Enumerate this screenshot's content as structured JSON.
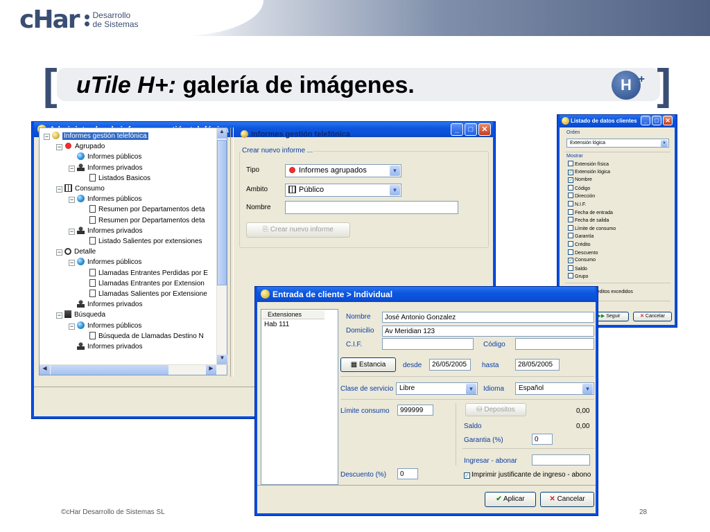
{
  "header": {
    "logo_text": "cHar",
    "logo_sub1": "Desarrollo",
    "logo_sub2": "de Sistemas",
    "title_italic": "uTile H+:",
    "title_rest": " galería de imágenes.",
    "badge_letter": "H"
  },
  "footer": {
    "copyright": "©cHar Desarrollo de Sistemas SL",
    "page": "28"
  },
  "win_admin": {
    "title": "Administrador de informes gestión telefónica",
    "tree": [
      {
        "label": "Informes gestión telefónica",
        "level": 0,
        "icon": "root-icon",
        "exp": "−"
      },
      {
        "label": "Agrupado",
        "level": 1,
        "icon": "red-icon",
        "exp": "−"
      },
      {
        "label": "Informes públicos",
        "level": 2,
        "icon": "globe-icon",
        "exp": ""
      },
      {
        "label": "Informes privados",
        "level": 2,
        "icon": "person-icon",
        "exp": "−"
      },
      {
        "label": "Listados Basicos",
        "level": 3,
        "icon": "document-icon",
        "exp": ""
      },
      {
        "label": "Consumo",
        "level": 1,
        "icon": "grid-icon",
        "exp": "−"
      },
      {
        "label": "Informes públicos",
        "level": 2,
        "icon": "globe-icon",
        "exp": "−"
      },
      {
        "label": "Resumen por Departamentos deta",
        "level": 3,
        "icon": "document-icon",
        "exp": ""
      },
      {
        "label": "Resumen por Departamentos deta",
        "level": 3,
        "icon": "document-icon",
        "exp": ""
      },
      {
        "label": "Informes privados",
        "level": 2,
        "icon": "person-icon",
        "exp": "−"
      },
      {
        "label": "Listado Salientes por extensiones",
        "level": 3,
        "icon": "document-icon",
        "exp": ""
      },
      {
        "label": "Detalle",
        "level": 1,
        "icon": "magnifier-icon",
        "exp": "−"
      },
      {
        "label": "Informes públicos",
        "level": 2,
        "icon": "globe-icon",
        "exp": "−"
      },
      {
        "label": "Llamadas Entrantes Perdidas por E",
        "level": 3,
        "icon": "document-icon",
        "exp": ""
      },
      {
        "label": "Llamadas Entrantes por Extension",
        "level": 3,
        "icon": "document-icon",
        "exp": ""
      },
      {
        "label": "Llamadas Salientes por Extensione",
        "level": 3,
        "icon": "document-icon",
        "exp": ""
      },
      {
        "label": "Informes privados",
        "level": 2,
        "icon": "person-icon",
        "exp": ""
      },
      {
        "label": "Búsqueda",
        "level": 1,
        "icon": "building-icon",
        "exp": "−"
      },
      {
        "label": "Informes públicos",
        "level": 2,
        "icon": "globe-icon",
        "exp": "−"
      },
      {
        "label": "Búsqueda de Llamadas Destino N",
        "level": 3,
        "icon": "document-icon",
        "exp": ""
      },
      {
        "label": "Informes privados",
        "level": 2,
        "icon": "person-icon",
        "exp": ""
      }
    ],
    "panel_title": "Informes gestión telefónica",
    "group_label": "Crear nuevo informe ...",
    "tipo_label": "Tipo",
    "tipo_value": "Informes agrupados",
    "ambito_label": "Ambito",
    "ambito_value": "Público",
    "nombre_label": "Nombre",
    "nombre_value": "",
    "create_button": "Crear nuevo informe"
  },
  "win_cliente": {
    "title": "Entrada de cliente > Individual",
    "ext_header": "Extensiones",
    "ext_items": [
      "Hab 111"
    ],
    "nombre_label": "Nombre",
    "nombre_value": "José Antonio Gonzalez",
    "domicilio_label": "Domicilio",
    "domicilio_value": "Av Meridian 123",
    "cif_label": "C.I.F.",
    "cif_value": "",
    "codigo_label": "Código",
    "codigo_value": "",
    "estancia_button": "Estancia",
    "desde_label": "desde",
    "desde_value": "26/05/2005",
    "hasta_label": "hasta",
    "hasta_value": "28/05/2005",
    "clase_label": "Clase de servicio",
    "clase_value": "Libre",
    "idioma_label": "Idioma",
    "idioma_value": "Español",
    "limite_label": "Límite consumo",
    "limite_value": "999999",
    "depositos_button": "Depositos",
    "depositos_amount": "0,00",
    "saldo_label": "Saldo",
    "saldo_amount": "0,00",
    "garantia_label": "Garantia (%)",
    "garantia_value": "0",
    "ingresar_label": "Ingresar - abonar",
    "ingresar_value": "",
    "descuento_label": "Descuento (%)",
    "descuento_value": "0",
    "imprimir_label": "Imprimir justificante de ingreso - abono",
    "aplicar_button": "Aplicar",
    "cancelar_button": "Cancelar"
  },
  "win_listado": {
    "title": "Listado de datos clientes",
    "orden_label": "Orden",
    "orden_value": "Extensión lógica",
    "mostrar_label": "Mostrar",
    "items": [
      {
        "label": "Extensión física",
        "checked": false
      },
      {
        "label": "Extensión lógica",
        "checked": true
      },
      {
        "label": "Nombre",
        "checked": true
      },
      {
        "label": "Código",
        "checked": false
      },
      {
        "label": "Dirección",
        "checked": false
      },
      {
        "label": "N.I.F.",
        "checked": false
      },
      {
        "label": "Fecha de entrada",
        "checked": false
      },
      {
        "label": "Fecha de salida",
        "checked": false
      },
      {
        "label": "Límite de consumo",
        "checked": false
      },
      {
        "label": "Garantía",
        "checked": false
      },
      {
        "label": "Crédito",
        "checked": false
      },
      {
        "label": "Descuento",
        "checked": false
      },
      {
        "label": "Consumo",
        "checked": true
      },
      {
        "label": "Saldo",
        "checked": false
      },
      {
        "label": "Grupo",
        "checked": false
      }
    ],
    "solo_label": "Solo creditos excedidos",
    "seguir_button": "Seguir",
    "cancelar_button": "Cancelar"
  }
}
